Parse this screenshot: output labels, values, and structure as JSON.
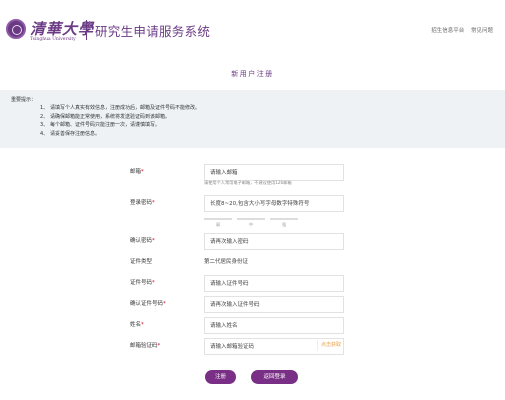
{
  "header": {
    "logo_cn": "清華大學",
    "logo_en": "Tsinghua University",
    "system_title": "研究生申请服务系统",
    "nav": [
      "招生信息平台",
      "常见问题"
    ]
  },
  "form_title": "新用户注册",
  "notice": {
    "title": "重要提示：",
    "items": [
      {
        "num": "1、",
        "text": "请填写个人真实有效信息，注册成功后，邮箱及证件号码不能修改。"
      },
      {
        "num": "2、",
        "text": "请确保邮箱能正常使用，系统将发送验证码到该邮箱。"
      },
      {
        "num": "3、",
        "text": "每个邮箱、证件号码只能注册一次，请谨慎填写。"
      },
      {
        "num": "4、",
        "text": "请妥善保存注册信息。"
      }
    ]
  },
  "form": {
    "email": {
      "label": "邮箱",
      "placeholder": "请输入邮箱",
      "hint": "请使用个人常用电子邮箱，不建议使用126邮箱"
    },
    "password": {
      "label": "登录密码",
      "placeholder": "长度8~20,包含大小写字母数字特殊符号",
      "strength": [
        "弱",
        "中",
        "强"
      ]
    },
    "confirm_password": {
      "label": "确认密码",
      "placeholder": "请再次输入密码"
    },
    "id_type": {
      "label": "证件类型",
      "value": "第二代居民身份证"
    },
    "id_number": {
      "label": "证件号码",
      "placeholder": "请输入证件号码"
    },
    "confirm_id": {
      "label": "确认证件号码",
      "placeholder": "请再次输入证件号码"
    },
    "name": {
      "label": "姓名",
      "placeholder": "请输入姓名"
    },
    "email_code": {
      "label": "邮箱验证码",
      "placeholder": "请输入邮箱验证码",
      "button": "点击获取"
    }
  },
  "buttons": {
    "register": "注册",
    "back": "返回登录"
  },
  "colors": {
    "brand": "#6b3a85",
    "button": "#7a2f86",
    "required": "#d0021b",
    "code_button": "#e8a24a",
    "notice_bg": "#eef2f5"
  }
}
